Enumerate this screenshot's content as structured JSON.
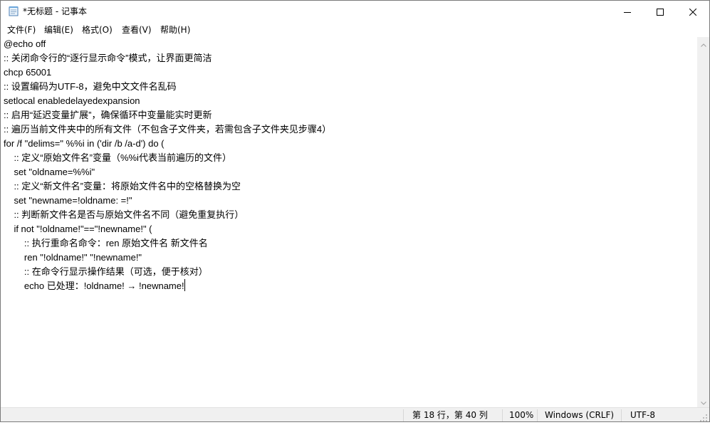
{
  "window": {
    "title": "*无标题 - 记事本"
  },
  "menu": {
    "file": "文件(F)",
    "edit": "编辑(E)",
    "format": "格式(O)",
    "view": "查看(V)",
    "help": "帮助(H)"
  },
  "editor": {
    "lines": [
      "@echo off",
      ":: 关闭命令行的“逐行显示命令”模式，让界面更简洁",
      "chcp 65001",
      ":: 设置编码为UTF-8，避免中文文件名乱码",
      "setlocal enabledelayedexpansion",
      ":: 启用“延迟变量扩展”，确保循环中变量能实时更新",
      ":: 遍历当前文件夹中的所有文件（不包含子文件夹，若需包含子文件夹见步骤4）",
      "for /f \"delims=\" %%i in ('dir /b /a-d') do (",
      "    :: 定义“原始文件名”变量（%%i代表当前遍历的文件）",
      "    set \"oldname=%%i\"",
      "    :: 定义“新文件名”变量：将原始文件名中的空格替换为空",
      "    set \"newname=!oldname: =!\"",
      "    :: 判断新文件名是否与原始文件名不同（避免重复执行）",
      "    if not \"!oldname!\"==\"!newname!\" (",
      "        :: 执行重命名命令：ren 原始文件名 新文件名",
      "        ren \"!oldname!\" \"!newname!\"",
      "        :: 在命令行显示操作结果（可选，便于核对）",
      "        echo 已处理：!oldname! → !newname!"
    ]
  },
  "status": {
    "position": "第 18 行，第 40 列",
    "zoom": "100%",
    "line_ending": "Windows (CRLF)",
    "encoding": "UTF-8"
  },
  "icons": {
    "app": "notepad-icon",
    "minimize": "minimize-icon",
    "maximize": "maximize-icon",
    "close": "close-icon"
  }
}
